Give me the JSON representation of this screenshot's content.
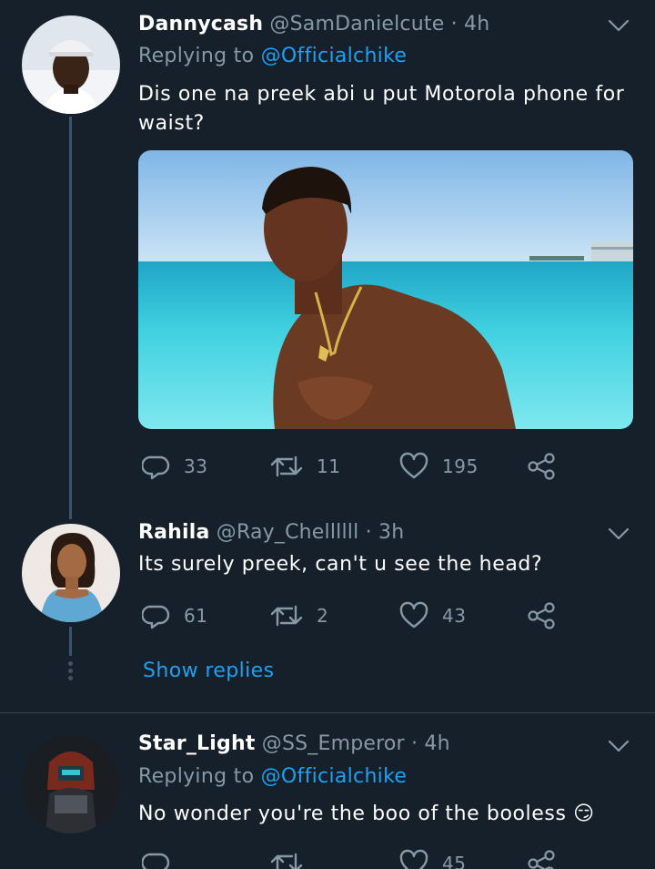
{
  "tweets": [
    {
      "name": "Dannycash",
      "handle": "@SamDanielcute",
      "sep": "·",
      "time": "4h",
      "replying_prefix": "Replying to ",
      "replying_to": "@Officialchike",
      "text": "Dis one na preek abi u put Motorola phone for waist?",
      "has_media": true,
      "replies": "33",
      "retweets": "11",
      "likes": "195"
    },
    {
      "name": "Rahila",
      "handle": "@Ray_Chellllll",
      "sep": "·",
      "time": "3h",
      "text": "Its surely preek, can't u see the head?",
      "replies": "61",
      "retweets": "2",
      "likes": "43"
    },
    {
      "name": "Star_Light",
      "handle": "@SS_Emperor",
      "sep": "·",
      "time": "4h",
      "replying_prefix": "Replying to ",
      "replying_to": "@Officialchike",
      "text": "No wonder you're the boo of the booless",
      "emoji": "😏",
      "replies": "",
      "retweets": "",
      "likes": "45"
    }
  ],
  "show_replies_label": "Show replies",
  "colors": {
    "background": "#15202b",
    "accent": "#1da1f2",
    "secondary_text": "#8899a6",
    "divider": "#38444d"
  },
  "icons": [
    "reply-icon",
    "retweet-icon",
    "like-icon",
    "share-icon",
    "chevron-down-icon"
  ]
}
